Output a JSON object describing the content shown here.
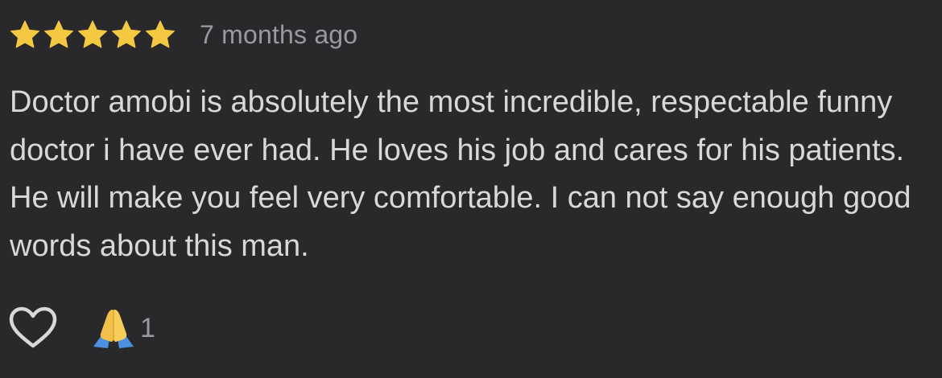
{
  "review": {
    "rating": 5,
    "rating_max": 5,
    "timestamp": "7 months ago",
    "text": "Doctor amobi is absolutely the most incredible, respectable funny doctor i have ever had. He loves his job and cares for his patients. He will make you feel very comfortable. I can not say enough good words about this man."
  },
  "actions": {
    "like_icon": "heart-outline-icon",
    "reaction_icon": "praying-hands-emoji",
    "reaction_count": "1"
  },
  "colors": {
    "background": "#29292b",
    "star": "#f5c842",
    "text": "#d8d8da",
    "muted": "#9a9a9e"
  }
}
